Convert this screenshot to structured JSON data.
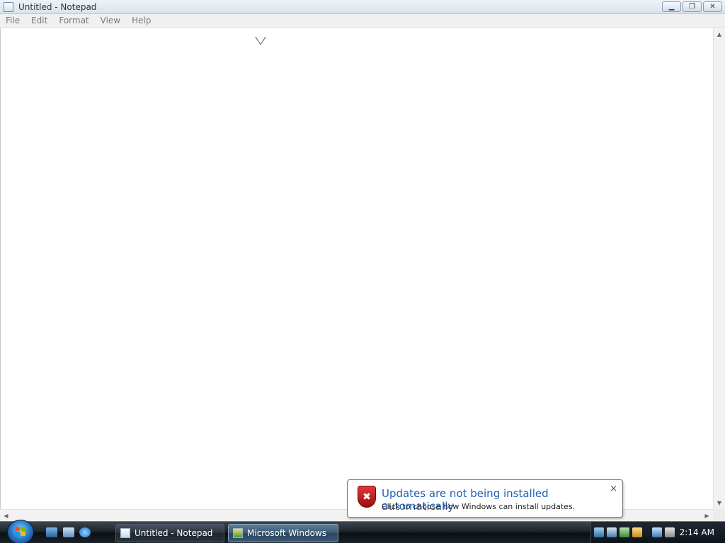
{
  "window": {
    "title": "Untitled - Notepad",
    "buttons": {
      "minimize": "▁",
      "restore": "❐",
      "close": "✕"
    }
  },
  "menu": {
    "items": [
      {
        "label": "File"
      },
      {
        "label": "Edit"
      },
      {
        "label": "Format"
      },
      {
        "label": "View"
      },
      {
        "label": "Help"
      }
    ]
  },
  "document": {
    "content": ""
  },
  "scrollbars": {
    "up_arrow": "▲",
    "down_arrow": "▼",
    "left_arrow": "◀",
    "right_arrow": "▶"
  },
  "taskbar": {
    "tasks": [
      {
        "label": "Untitled - Notepad",
        "icon": "notepad-icon"
      },
      {
        "label": "Microsoft Windows",
        "icon": "windows-setup-icon",
        "active": true
      }
    ],
    "clock": "2:14 AM"
  },
  "notification": {
    "title": "Updates are not being installed automatically",
    "body": "Click to choose how Windows can install updates.",
    "close": "×",
    "icon": "shield-error-icon",
    "shield_glyph": "✖"
  },
  "colors": {
    "notification_title": "#1e5eb6",
    "shield": "#c41e1e"
  }
}
